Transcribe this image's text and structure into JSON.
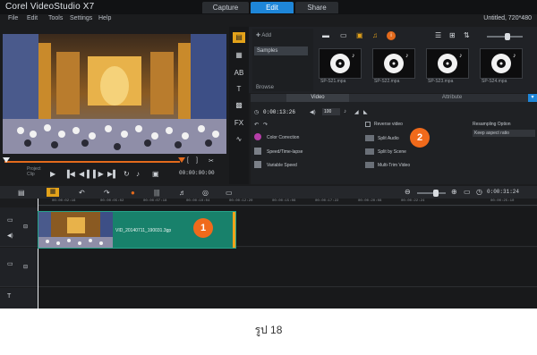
{
  "app": {
    "title": "Corel VideoStudio X7",
    "file_name": "Untitled, 720*480"
  },
  "workspace_tabs": [
    {
      "label": "Capture"
    },
    {
      "label": "Edit",
      "active": true
    },
    {
      "label": "Share"
    }
  ],
  "menu": [
    "File",
    "Edit",
    "Tools",
    "Settings",
    "Help"
  ],
  "player": {
    "mode_label": "Project",
    "mode_sub": "Clip",
    "timecode": "00:00:00:00"
  },
  "library": {
    "add_label": "Add",
    "browse_label": "Browse",
    "folder": "Samples",
    "thumbnails": [
      "SP-S21.mpa",
      "SP-S22.mpa",
      "SP-S23.mpa",
      "SP-S24.mpa"
    ]
  },
  "options": {
    "tabs": [
      {
        "label": "Video",
        "active": true
      },
      {
        "label": "Attribute"
      }
    ],
    "duration": "0:00:13:26",
    "zoom": "100",
    "items_left": [
      "Color Correction",
      "Speed/Time-lapse",
      "Variable Speed"
    ],
    "items_right": [
      "Reverse video",
      "Split Audio",
      "Split by Scene",
      "Multi-Trim Video"
    ],
    "resampling_label": "Resampling Option",
    "resampling_value": "Keep aspect ratio"
  },
  "timeline": {
    "ruler_ticks": [
      "00:00:00:00",
      "00:00:02:16",
      "00:00:05:02",
      "00:00:07:18",
      "00:00:10:04",
      "00:00:12:20",
      "00:00:15:06",
      "00:00:17:22",
      "00:00:20:08",
      "00:00:22:24",
      "00:00:25:10"
    ],
    "timecode": "0:00:13:26",
    "end_timecode": "0:00:31:24",
    "clip_name": "VID_20140711_190031.3gp"
  },
  "badges": [
    "1",
    "2"
  ],
  "caption": "รูป 18",
  "colors": {
    "accent": "#1e86d8",
    "clip": "#18816b",
    "badge": "#f06a1b"
  }
}
